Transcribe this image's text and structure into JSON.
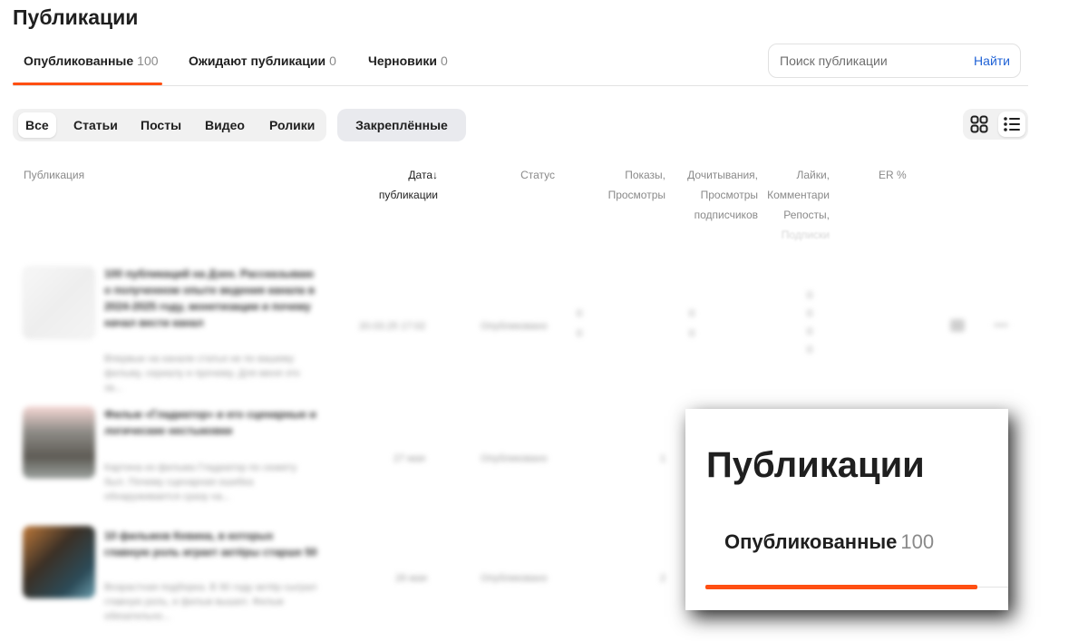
{
  "page_title": "Публикации",
  "tabs": [
    {
      "label": "Опубликованные",
      "count": "100"
    },
    {
      "label": "Ожидают публикации",
      "count": "0"
    },
    {
      "label": "Черновики",
      "count": "0"
    }
  ],
  "search": {
    "placeholder": "Поиск публикации",
    "button_label": "Найти"
  },
  "filters": [
    "Все",
    "Статьи",
    "Посты",
    "Видео",
    "Ролики"
  ],
  "pinned_label": "Закреплённые",
  "view_toggle": {
    "grid_icon": "grid-icon",
    "list_icon": "list-icon",
    "active": "list"
  },
  "table_headers": {
    "publication": "Публикация",
    "date_line1": "Дата",
    "date_arrow": "↓",
    "date_line2": "публикации",
    "status": "Статус",
    "views_line1": "Показы,",
    "views_line2": "Просмотры",
    "reads_line1": "Дочитывания,",
    "reads_line2": "Просмотры",
    "reads_line3": "подписчиков",
    "likes_line1": "Лайки,",
    "likes_line2": "Комментари",
    "likes_line3": "Репосты,",
    "likes_line4": "Подписки",
    "er": "ER %"
  },
  "rows": [
    {
      "title": "100 публикаций на Дзен. Рассказываю о полученном опыте ведения канала в 2024-2025 году, монетизации и почему начал вести канал",
      "excerpt": "Впервые на канале статья не по вашему фильму, сериалу и прочему. Для меня это за...",
      "date": "20.03.25 17:02",
      "status": "Опубликовано",
      "views": "0",
      "views2": "0",
      "reads": "0",
      "reads2": "0",
      "likes": "0",
      "comments": "0",
      "reposts": "0",
      "subs": "0"
    },
    {
      "title": "Фильм «Гладиатор» и его сценарные и логические нестыковки",
      "excerpt": "Картина из фильма Гладиатор по сюжету был. Почему сценарная ошибка обнаруживается сразу на...",
      "date": "27 мая",
      "status": "Опубликовано",
      "views": "1"
    },
    {
      "title": "10 фильмов Кевина, в которых главную роль играет актёры старше 50",
      "excerpt": "Возрастная подборка. В 90 году актёр сыграл главную роль, и фильм вышел. Фильм обязательно...",
      "date": "26 мая",
      "status": "Опубликовано",
      "views": "2"
    }
  ],
  "zoom": {
    "title": "Публикации",
    "tab_label": "Опубликованные",
    "tab_count": "100"
  },
  "colors": {
    "accent": "#ff4f12",
    "link": "#1f62d6"
  }
}
